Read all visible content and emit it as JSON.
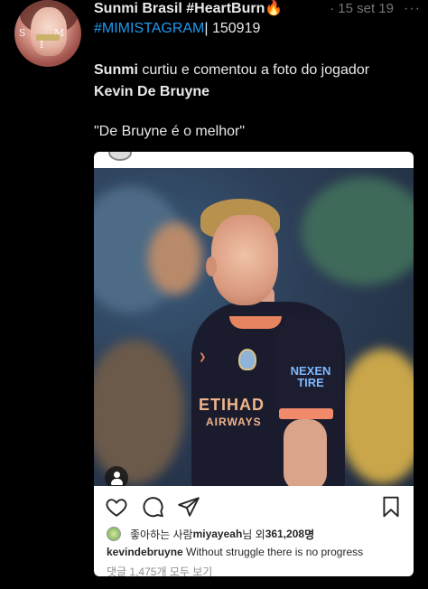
{
  "tweet": {
    "author_name": "Sunmi Brasil #HeartBurn",
    "author_emoji": "🔥",
    "more_label": "···",
    "separator": "·",
    "date": "15 set 19",
    "hashtag": "#MIMISTAGRAM",
    "hashtag_suffix": "| 150919",
    "line1_bold": "Sunmi",
    "line1_rest": " curtiu e comentou a foto do jogador",
    "line2": "Kevin De Bruyne",
    "quote": "\"De Bruyne é o melhor\""
  },
  "avatar": {
    "letters": "S  M I"
  },
  "instagram": {
    "likes_prefix": "좋아하는 사람 ",
    "likes_user": "miyayeah",
    "likes_mid": "님 외 ",
    "likes_count": "361,208",
    "likes_suffix": "명",
    "caption_user": "kevindebruyne",
    "caption_text": " Without struggle there is no progress",
    "comments_link": "댓글 1,475개 모두 보기",
    "photo_text_sponsor": "ETIHAD",
    "photo_text_sponsor2": "AIRWAYS",
    "photo_text_sleeve": "NEXEN TIRE"
  },
  "colors": {
    "background": "#000000",
    "text": "#e7e9ea",
    "muted": "#71767b",
    "link": "#1d9bf0"
  }
}
